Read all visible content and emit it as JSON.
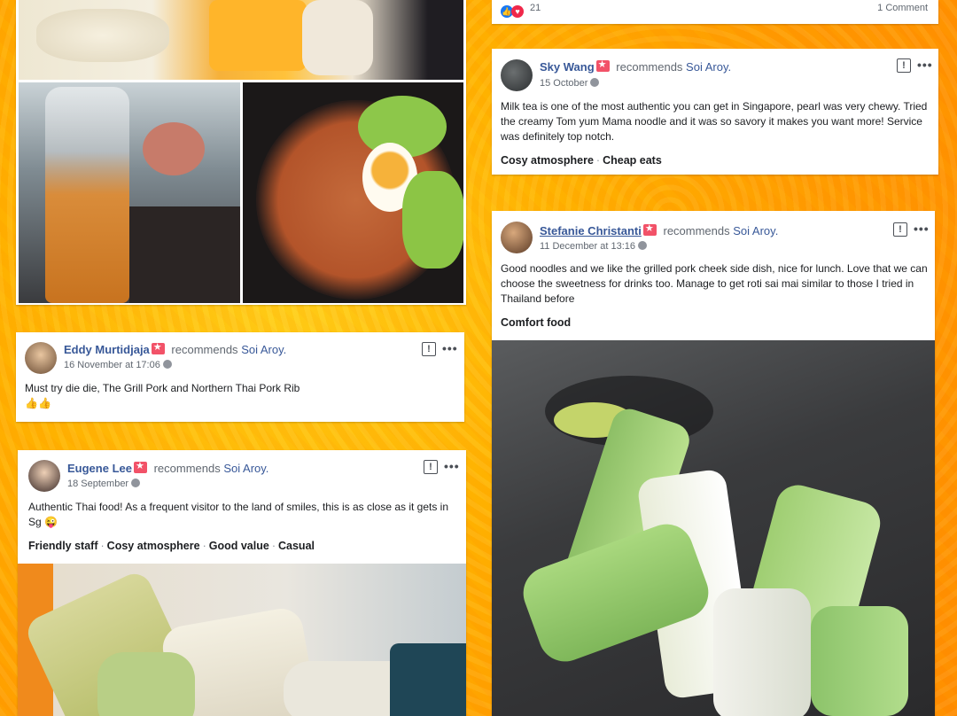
{
  "post_top": {
    "reaction_count": "21",
    "comment_count": "1 Comment",
    "reaction_icons": [
      "like-icon",
      "love-icon"
    ]
  },
  "reviews": [
    {
      "author": "Sky Wang",
      "action": "recommends",
      "page": "Soi Aroy.",
      "date": "15 October",
      "text": "Milk tea is one of the most authentic you can get in Singapore, pearl was very chewy. Tried the creamy Tom yum Mama noodle and it was so savory it makes you want more! Service was definitely top notch.",
      "tags": [
        "Cosy atmosphere",
        "Cheap eats"
      ]
    },
    {
      "author": "Stefanie Christanti",
      "action": "recommends",
      "page": "Soi Aroy.",
      "date": "11 December at 13:16",
      "text": "Good noodles and we like the grilled pork cheek side dish, nice for lunch. Love that we can choose the sweetness for drinks too. Manage to get roti sai mai similar to those I tried in Thailand before",
      "tags": [
        "Comfort food"
      ]
    },
    {
      "author": "Eddy Murtidjaja",
      "action": "recommends",
      "page": "Soi Aroy.",
      "date": "16 November at 17:06",
      "text": "Must try die die, The Grill Pork and Northern Thai Pork Rib",
      "emoji": "👍👍",
      "tags": []
    },
    {
      "author": "Eugene Lee",
      "action": "recommends",
      "page": "Soi Aroy.",
      "date": "18 September",
      "text": "Authentic Thai food! As a frequent visitor to the land of smiles, this is as close as it gets in Sg 😜",
      "tags": [
        "Friendly staff",
        "Cosy atmosphere",
        "Good value",
        "Casual"
      ]
    }
  ],
  "tag_separator": "·",
  "icons": {
    "report": "!",
    "more": "•••"
  }
}
